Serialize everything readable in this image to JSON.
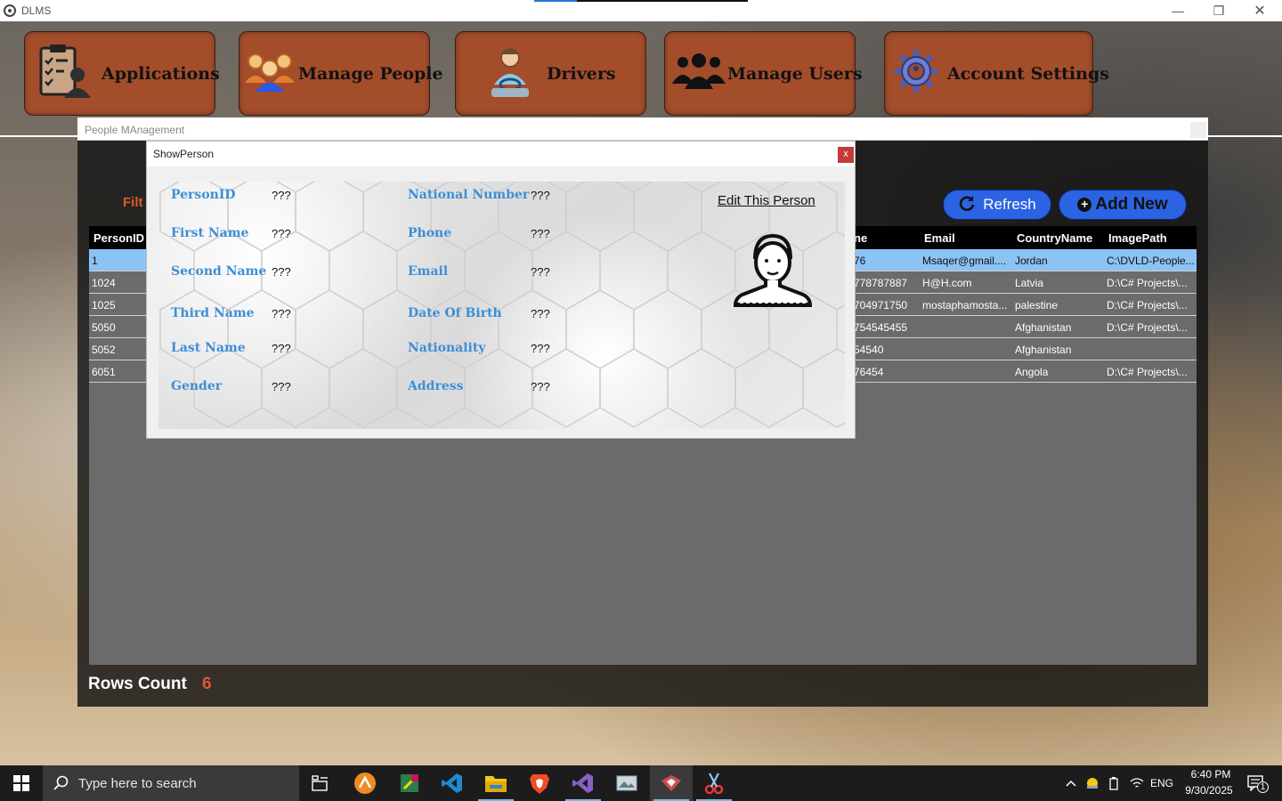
{
  "window": {
    "title": "DLMS",
    "minimize": "—",
    "maximize": "❐",
    "close": "✕"
  },
  "nav": {
    "applications": "Applications",
    "people": "Manage People",
    "drivers": "Drivers",
    "users": "Manage Users",
    "settings": "Account Settings"
  },
  "people_form": {
    "title": "People MAnagement",
    "filter_label": "Filt",
    "refresh_label": "Refresh",
    "add_new_label": "Add New",
    "rows_count_label": "Rows Count",
    "rows_count_value": "6",
    "grid": {
      "headers": {
        "person_id": "PersonID",
        "phone_partial": "ne",
        "email": "Email",
        "country": "CountryName",
        "image": "ImagePath"
      },
      "rows": [
        {
          "id": "1",
          "phone": "76",
          "email": "Msaqer@gmail....",
          "country": "Jordan",
          "image": "C:\\DVLD-People..."
        },
        {
          "id": "1024",
          "phone": "778787887",
          "email": "H@H.com",
          "country": "Latvia",
          "image": "D:\\C# Projects\\..."
        },
        {
          "id": "1025",
          "phone": "704971750",
          "email": "mostaphamosta...",
          "country": "palestine",
          "image": "D:\\C# Projects\\..."
        },
        {
          "id": "5050",
          "phone": "754545455",
          "email": "",
          "country": "Afghanistan",
          "image": "D:\\C# Projects\\..."
        },
        {
          "id": "5052",
          "phone": "54540",
          "email": "",
          "country": "Afghanistan",
          "image": ""
        },
        {
          "id": "6051",
          "phone": "76454",
          "email": "",
          "country": "Angola",
          "image": "D:\\C# Projects\\..."
        }
      ]
    }
  },
  "show_person": {
    "title": "ShowPerson",
    "close": "x",
    "edit_link": "Edit This Person",
    "left_fields": [
      {
        "label": "PersonID",
        "value": "???"
      },
      {
        "label": "First Name",
        "value": "???"
      },
      {
        "label": "Second Name",
        "value": "???"
      },
      {
        "label": "Third Name",
        "value": "???"
      },
      {
        "label": "Last Name",
        "value": "???"
      },
      {
        "label": "Gender",
        "value": "???"
      }
    ],
    "right_fields": [
      {
        "label": "National Number",
        "value": "???"
      },
      {
        "label": "Phone",
        "value": "???"
      },
      {
        "label": "Email",
        "value": "???"
      },
      {
        "label": "Date Of Birth",
        "value": "???"
      },
      {
        "label": "Nationality",
        "value": "???"
      },
      {
        "label": "Address",
        "value": "???"
      }
    ]
  },
  "taskbar": {
    "search_placeholder": "Type here to search",
    "language": "ENG",
    "time": "6:40 PM",
    "date": "9/30/2025",
    "notification_count": "1"
  },
  "colors": {
    "nav_button": "#a34d2b",
    "field_label": "#3d8ed6",
    "selected_row": "#8cc3f5",
    "pill_button": "#2b63e3",
    "rows_count_value": "#e0553a"
  }
}
